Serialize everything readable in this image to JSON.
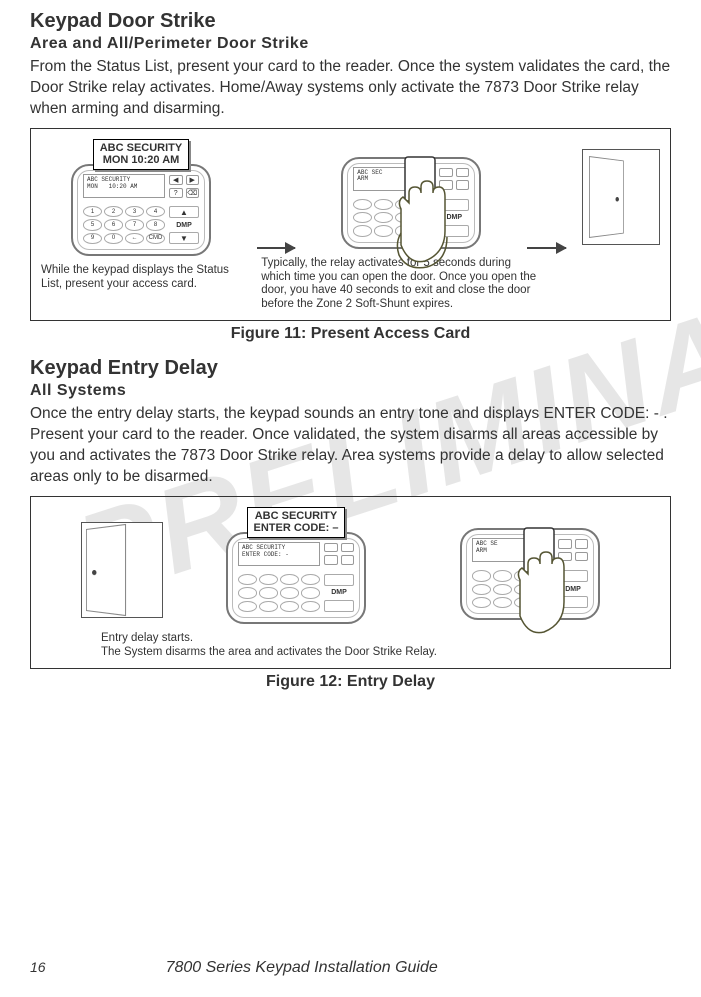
{
  "section1": {
    "heading": "Keypad Door Strike",
    "subheading": "Area and All/Perimeter Door Strike",
    "paragraph": "From the Status List, present your card to the reader.  Once the system validates the card, the Door Strike relay activates.  Home/Away systems only activate the 7873 Door Strike relay when arming and disarming."
  },
  "figure11": {
    "lcd_line1": "ABC SECURITY",
    "lcd_line2": "MON    10:20 AM",
    "keypad_lcd_full": "ABC SECURITY\nMON   10:20 AM",
    "keypad_lcd_partial": "ABC SEC\nARM",
    "left_caption": "While the keypad displays the Status List, present your access card.",
    "right_caption": "Typically, the relay activates for 5 seconds during which time you can open the door.  Once you open the door, you have 40 seconds to exit and close the door before the Zone 2 Soft-Shunt expires.",
    "caption": "Figure 11: Present Access Card"
  },
  "section2": {
    "heading": "Keypad Entry Delay",
    "subheading": "All Systems",
    "paragraph": "Once the entry delay starts, the keypad sounds an entry tone and displays ENTER CODE:  - . Present your card to the reader.  Once validated, the system disarms all areas accessible by you and activates the 7873 Door Strike relay.  Area systems provide a delay to allow selected areas only to be disarmed."
  },
  "figure12": {
    "lcd_line1": "ABC SECURITY",
    "lcd_line2": "ENTER CODE: –",
    "keypad_lcd_full": "ABC SECURITY\nENTER CODE: -",
    "keypad_lcd_partial": "ABC SE\nARM",
    "caption_below": "Entry delay starts.\nThe System disarms the area and activates the Door Strike Relay.",
    "caption": "Figure 12: Entry Delay"
  },
  "keypad": {
    "soft_labels": [
      "◀",
      "▶",
      "?",
      "⌫"
    ],
    "num_labels": [
      "1",
      "2",
      "3",
      "4",
      "5",
      "6",
      "7",
      "8",
      "9",
      "0",
      "←",
      "CMD"
    ],
    "arrows": [
      "▲",
      "▼"
    ],
    "brand": "DMP"
  },
  "footer": {
    "page": "16",
    "title": "7800 Series Keypad Installation Guide"
  },
  "watermark": "PRELIMINARY"
}
